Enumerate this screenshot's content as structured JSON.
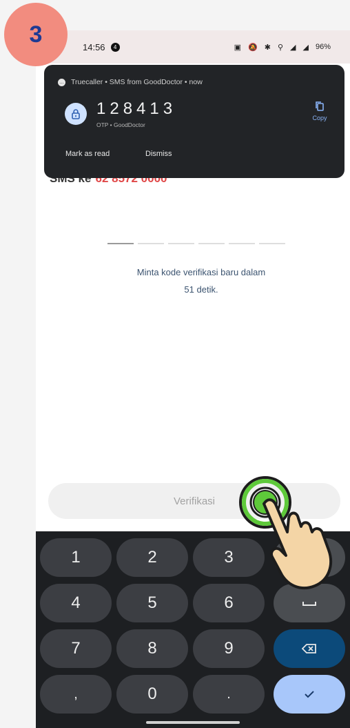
{
  "step_badge": "3",
  "status_bar": {
    "time": "14:56",
    "notification_count": "4",
    "battery_percent": "96%"
  },
  "notification": {
    "header": "Truecaller • SMS from GoodDoctor • now",
    "otp_code": "128413",
    "otp_subtitle": "OTP • GoodDoctor",
    "copy_label": "Copy",
    "actions": [
      "Mark as read",
      "Dismiss"
    ]
  },
  "resend_text_line1": "Minta kode verifikasi baru dalam",
  "resend_text_line2": "51 detik.",
  "verify_button": "Verifikasi",
  "keyboard": {
    "rows": [
      [
        "1",
        "2",
        "3"
      ],
      [
        "4",
        "5",
        "6"
      ],
      [
        "7",
        "8",
        "9"
      ],
      [
        ",",
        "0",
        "."
      ]
    ],
    "backspace_icon": "backspace-icon",
    "space_icon": "space-icon",
    "enter_icon": "check-icon"
  },
  "colors": {
    "badge": "#f28c7f",
    "badge_text": "#1f3a93",
    "notification_bg": "#222427",
    "copy_accent": "#8ab4f8",
    "keyboard_bg": "#1d1f22",
    "enter_key": "#a8c7fa",
    "backspace_key": "#0c4a7a",
    "tap_indicator": "#5ec93a"
  }
}
